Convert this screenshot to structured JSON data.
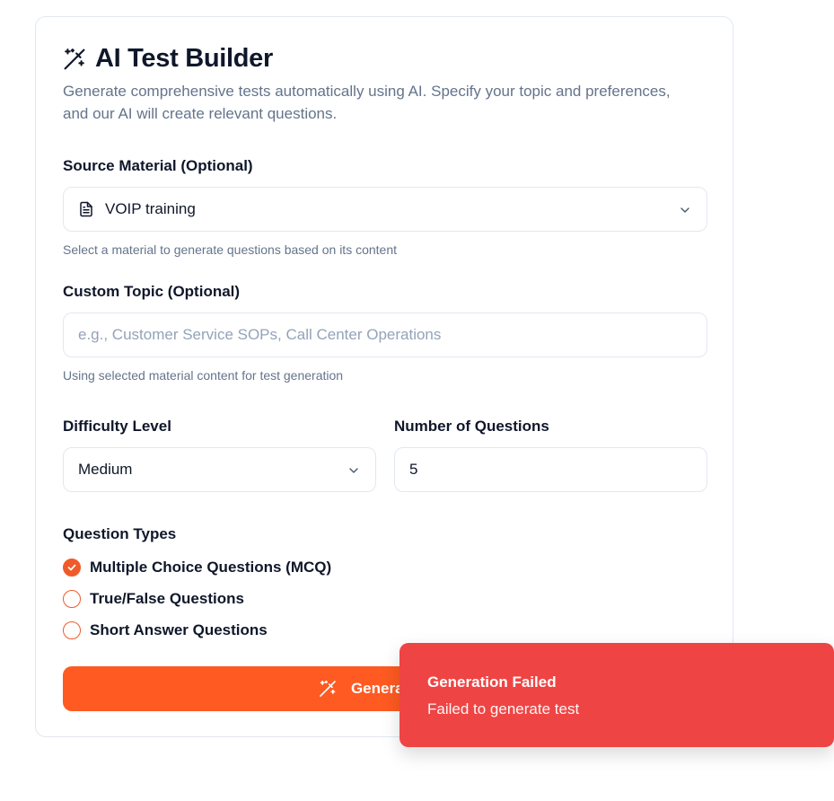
{
  "header": {
    "title": "AI Test Builder",
    "icon": "wand-sparkles-icon",
    "description": "Generate comprehensive tests automatically using AI. Specify your topic and preferences, and our AI will create relevant questions."
  },
  "source_material": {
    "label": "Source Material (Optional)",
    "value": "VOIP training",
    "icon": "file-text-icon",
    "hint": "Select a material to generate questions based on its content"
  },
  "custom_topic": {
    "label": "Custom Topic (Optional)",
    "placeholder": "e.g., Customer Service SOPs, Call Center Operations",
    "value": "",
    "hint": "Using selected material content for test generation"
  },
  "difficulty": {
    "label": "Difficulty Level",
    "value": "Medium"
  },
  "num_questions": {
    "label": "Number of Questions",
    "value": "5"
  },
  "question_types": {
    "label": "Question Types",
    "items": [
      {
        "label": "Multiple Choice Questions (MCQ)",
        "checked": true
      },
      {
        "label": "True/False Questions",
        "checked": false
      },
      {
        "label": "Short Answer Questions",
        "checked": false
      }
    ]
  },
  "generate_button": {
    "label": "Generate Test"
  },
  "toast": {
    "title": "Generation Failed",
    "message": "Failed to generate test"
  },
  "colors": {
    "accent": "#fe5a22",
    "toast_bg": "#ef4444"
  }
}
